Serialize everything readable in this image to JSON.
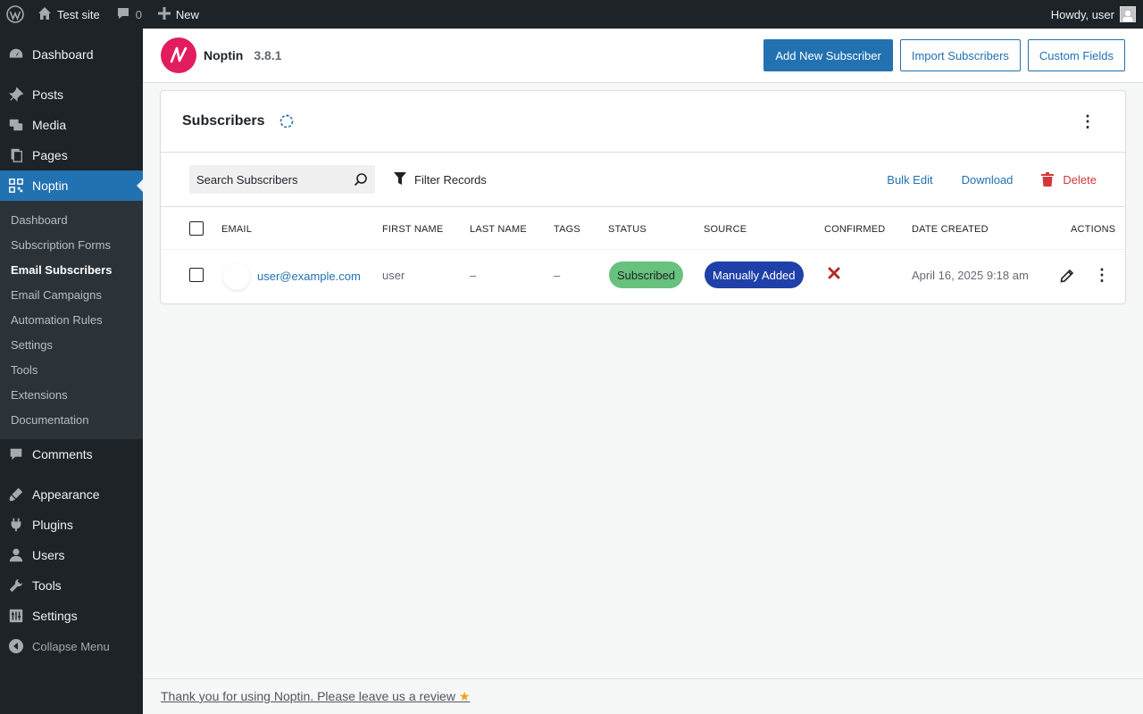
{
  "adminbar": {
    "site_name": "Test site",
    "comments_count": "0",
    "new_label": "New",
    "greeting": "Howdy, user"
  },
  "sidebar": {
    "items_top": [
      {
        "label": "Dashboard",
        "icon": "dashboard-icon"
      }
    ],
    "items_main": [
      {
        "label": "Posts",
        "icon": "pin-icon"
      },
      {
        "label": "Media",
        "icon": "media-icon"
      },
      {
        "label": "Pages",
        "icon": "pages-icon"
      },
      {
        "label": "Noptin",
        "icon": "noptin-icon"
      }
    ],
    "noptin_submenu": [
      {
        "label": "Dashboard"
      },
      {
        "label": "Subscription Forms"
      },
      {
        "label": "Email Subscribers"
      },
      {
        "label": "Email Campaigns"
      },
      {
        "label": "Automation Rules"
      },
      {
        "label": "Settings"
      },
      {
        "label": "Tools"
      },
      {
        "label": "Extensions"
      },
      {
        "label": "Documentation"
      }
    ],
    "items_bottom1": [
      {
        "label": "Comments",
        "icon": "comments-icon"
      }
    ],
    "items_bottom2": [
      {
        "label": "Appearance",
        "icon": "appearance-icon"
      },
      {
        "label": "Plugins",
        "icon": "plugins-icon"
      },
      {
        "label": "Users",
        "icon": "users-icon"
      },
      {
        "label": "Tools",
        "icon": "tools-icon"
      },
      {
        "label": "Settings",
        "icon": "settings-icon"
      }
    ],
    "collapse_label": "Collapse Menu"
  },
  "header": {
    "brand_name": "Noptin",
    "version": "3.8.1",
    "buttons": {
      "add_new": "Add New Subscriber",
      "import": "Import Subscribers",
      "custom_fields": "Custom Fields"
    }
  },
  "card": {
    "title": "Subscribers",
    "search_placeholder": "Search Subscribers",
    "filter_label": "Filter Records",
    "bulk_edit": "Bulk Edit",
    "download": "Download",
    "delete": "Delete",
    "columns": {
      "email": "EMAIL",
      "first_name": "FIRST NAME",
      "last_name": "LAST NAME",
      "tags": "TAGS",
      "status": "STATUS",
      "source": "SOURCE",
      "confirmed": "CONFIRMED",
      "date_created": "DATE CREATED",
      "actions": "ACTIONS"
    },
    "rows": [
      {
        "email": "user@example.com",
        "first_name": "user",
        "last_name": "–",
        "tags": "–",
        "status": "Subscribed",
        "source": "Manually Added",
        "confirmed": false,
        "date_created": "April 16, 2025 9:18 am"
      }
    ]
  },
  "footer": {
    "text": "Thank you for using Noptin. Please leave us a review"
  },
  "colors": {
    "accent": "#2271b1",
    "adminbar": "#1d2327",
    "status_subscribed": "#68c17c",
    "source_pill": "#1e40a8",
    "danger": "#d63638",
    "logo": "#e11d5e"
  }
}
